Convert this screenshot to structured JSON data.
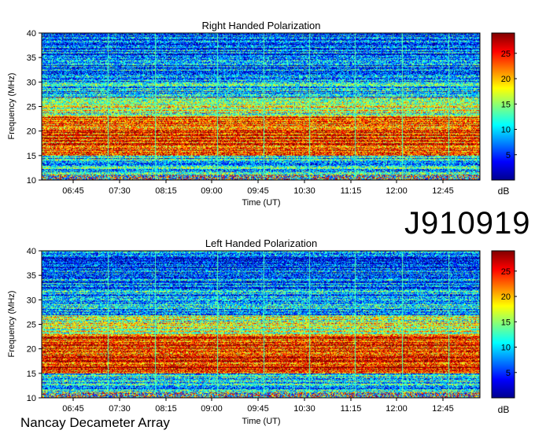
{
  "station_id": "J910919",
  "array_name": "Nancay Decameter Array",
  "chart_data": [
    {
      "type": "heatmap",
      "title": "Right Handed Polarization",
      "xlabel": "Time (UT)",
      "ylabel": "Frequency (MHz)",
      "x_ticks": [
        "06:45",
        "07:30",
        "08:15",
        "09:00",
        "09:45",
        "10:30",
        "11:15",
        "12:00",
        "12:45"
      ],
      "y_ticks": [
        10,
        15,
        20,
        25,
        30,
        35,
        40
      ],
      "ylim": [
        10,
        40
      ],
      "colorbar": {
        "label": "dB",
        "ticks": [
          5,
          10,
          15,
          20,
          25
        ],
        "range": [
          0,
          29
        ]
      }
    },
    {
      "type": "heatmap",
      "title": "Left Handed Polarization",
      "xlabel": "Time (UT)",
      "ylabel": "Frequency (MHz)",
      "x_ticks": [
        "06:45",
        "07:30",
        "08:15",
        "09:00",
        "09:45",
        "10:30",
        "11:15",
        "12:00",
        "12:45"
      ],
      "y_ticks": [
        10,
        15,
        20,
        25,
        30,
        35,
        40
      ],
      "ylim": [
        10,
        40
      ],
      "colorbar": {
        "label": "dB",
        "ticks": [
          5,
          10,
          15,
          20,
          25
        ],
        "range": [
          0,
          29
        ]
      }
    }
  ]
}
